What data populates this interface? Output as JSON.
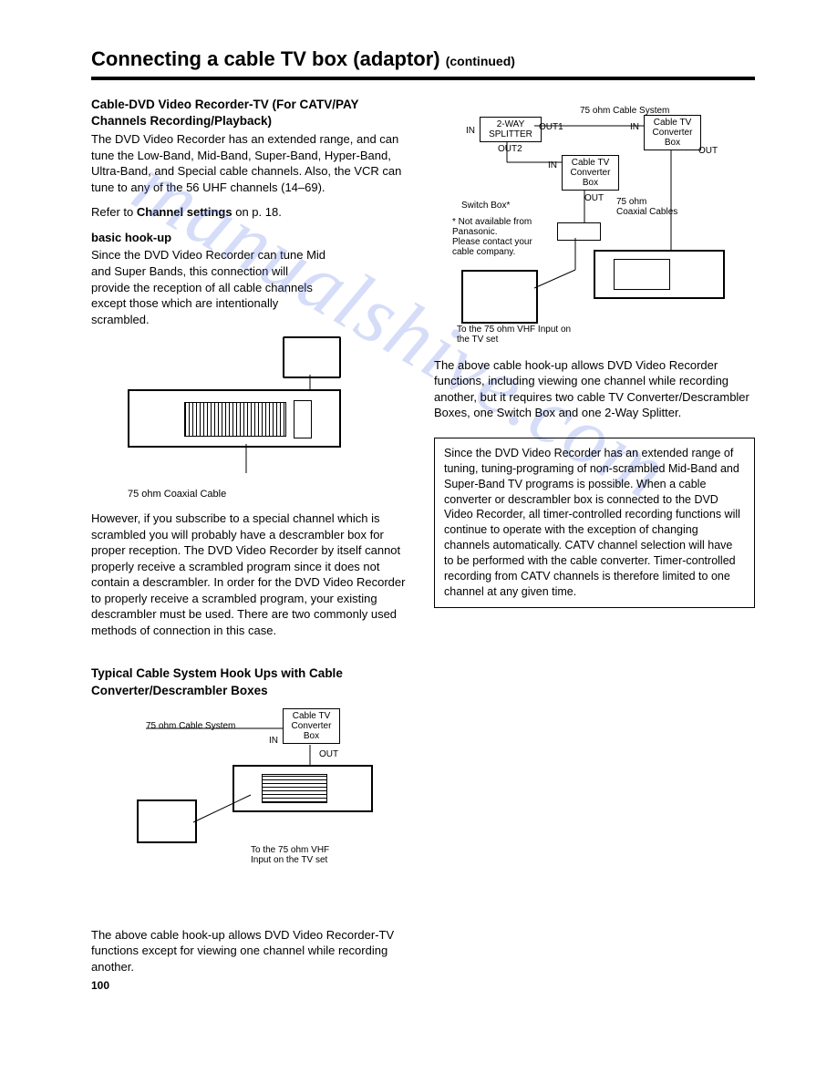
{
  "title_main": "Connecting a cable TV box (adaptor)",
  "title_cont": "(continued)",
  "left": {
    "h1": "Cable-DVD Video Recorder-TV (For CATV/PAY Channels Recording/Playback)",
    "p1a": "The DVD Video Recorder has an extended range, and can tune the Low-Band, Mid-Band, Super-Band, Hyper-Band, Ultra-Band, and Special cable channels. Also, the VCR can tune to any of the 56 UHF channels (14–69).",
    "p1b_prefix": "Refer to ",
    "p1b_bold": "Channel settings",
    "p1b_suffix": " on p. 18.",
    "h2": "basic hook-up",
    "p2a": "Since the DVD Video Recorder can tune Mid and Super Bands, this connection will provide the reception of all cable channels except those which are intentionally scrambled.",
    "basic_caption": "75 ohm Coaxial Cable",
    "p3": "However, if you subscribe to a special channel which is scrambled you will probably have a descrambler box for proper reception. The DVD Video Recorder by itself cannot properly receive a scrambled program since it does not contain a descrambler. In order for the DVD Video Recorder to properly receive a scrambled program, your existing descrambler must be used. There are two commonly used methods of connection in this case.",
    "h3": "Typical Cable System Hook Ups with Cable Converter/Descrambler Boxes",
    "typ_lbl_75": "75 ohm Cable System",
    "typ_lbl_box": "Cable TV\nConverter\nBox",
    "typ_lbl_in": "IN",
    "typ_lbl_out": "OUT",
    "typ_caption": "To the 75 ohm VHF Input on the TV set",
    "p4": "The above cable hook-up allows DVD Video Recorder-TV functions except for viewing one channel while recording another."
  },
  "right": {
    "schem": {
      "top_label": "75 ohm Cable System",
      "splitter": "2-WAY\nSPLITTER",
      "in": "IN",
      "out1": "OUT1",
      "out2": "OUT2",
      "out": "OUT",
      "conv1": "Cable TV\nConverter\nBox",
      "conv2": "Cable TV\nConverter\nBox",
      "switch": "Switch Box*",
      "coax": "75 ohm\nCoaxial Cables",
      "note": "* Not available from Panasonic.\nPlease contact your cable company.",
      "tv_caption": "To the 75 ohm VHF Input on the TV set"
    },
    "p1": "The above cable hook-up allows DVD Video Recorder functions, including viewing one channel while recording another, but it requires two cable TV Converter/Descrambler Boxes, one Switch Box and one 2-Way Splitter.",
    "boxed": "Since the DVD Video Recorder has an extended range of tuning, tuning-programing of non-scrambled Mid-Band and Super-Band TV programs is possible. When a cable converter or descrambler box is connected to the DVD Video Recorder, all timer-controlled recording functions will continue to operate with the exception of changing channels automatically. CATV channel selection will have to be performed with the cable converter. Timer-controlled recording from CATV channels is therefore limited to one channel at any given time."
  },
  "page_number": "100",
  "watermark": "manualshive.com"
}
